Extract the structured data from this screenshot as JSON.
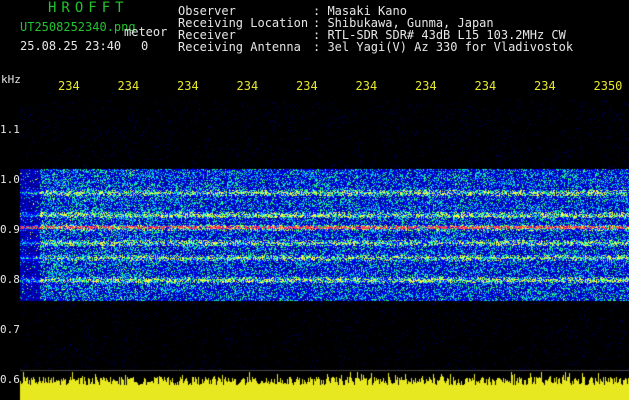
{
  "header": {
    "brand": "HROFFT",
    "filename": "UT2508252340.png",
    "tag": "meteor",
    "timestamp": "25.08.25 23:40",
    "count": "0",
    "fields": [
      {
        "key": "Observer",
        "value": ": Masaki Kano"
      },
      {
        "key": "Receiving Location",
        "value": ": Shibukawa, Gunma, Japan"
      },
      {
        "key": "Receiver",
        "value": ": RTL-SDR SDR# 43dB L15 103.2MHz CW"
      },
      {
        "key": "Receiving Antenna",
        "value": ": 3el Yagi(V) Az 330 for Vladivostok"
      }
    ]
  },
  "chart_data": {
    "type": "heatmap",
    "y_unit_label": "kHz",
    "y_ticks": [
      "1.1",
      "1.0",
      "0.9",
      "0.8",
      "0.7",
      "0.6"
    ],
    "x_ticks": [
      "234",
      "234",
      "234",
      "234",
      "234",
      "234",
      "234",
      "234",
      "234",
      "2350"
    ],
    "x_tick_minutes": [
      0,
      1,
      2,
      3,
      4,
      5,
      6,
      7,
      8,
      9,
      10
    ],
    "ylim": [
      0.6,
      1.15
    ],
    "signal_band": [
      0.76,
      1.02
    ],
    "bright_lines_khz": [
      0.8,
      0.845,
      0.875,
      0.905,
      0.93,
      0.975
    ],
    "strongest_line_khz": 0.905,
    "noise_floor_color": "#000080",
    "signal_color": "#0000ff",
    "hot_color": "#ff3050",
    "level_bar_color": "#e8e820"
  }
}
